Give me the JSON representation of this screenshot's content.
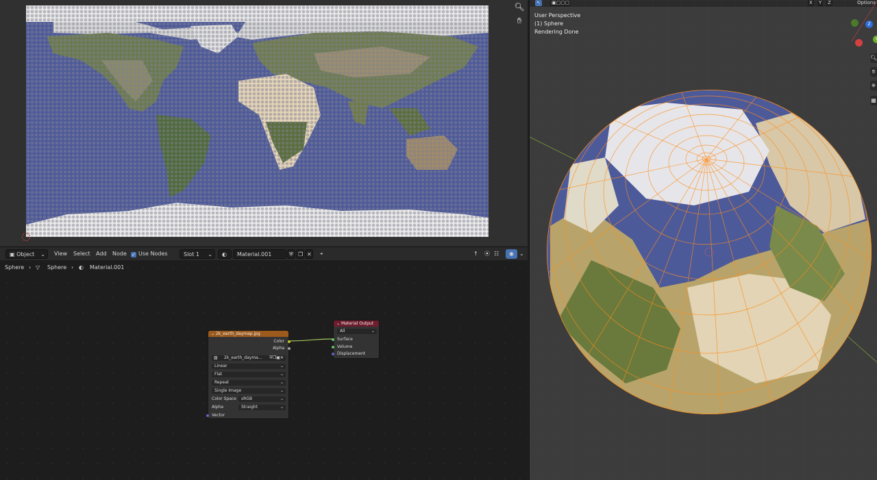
{
  "uv_editor": {
    "tools": {
      "zoom_icon": "zoom-icon",
      "pan_icon": "hand-icon"
    }
  },
  "node_editor": {
    "header": {
      "mode": "Object",
      "menu_view": "View",
      "menu_select": "Select",
      "menu_add": "Add",
      "menu_node": "Node",
      "use_nodes_label": "Use Nodes",
      "slot": "Slot 1",
      "material": "Material.001"
    },
    "breadcrumb": {
      "object": "Sphere",
      "mesh": "Sphere",
      "material": "Material.001"
    },
    "image_node": {
      "title": "2k_earth_daymap.jpg",
      "out_color": "Color",
      "out_alpha": "Alpha",
      "image_name": "2k_earth_dayma...",
      "interpolation": "Linear",
      "projection": "Flat",
      "extension": "Repeat",
      "source": "Single Image",
      "color_space_label": "Color Space",
      "color_space": "sRGB",
      "alpha_label": "Alpha",
      "alpha_mode": "Straight",
      "in_vector": "Vector",
      "header_color": "#9c5a1d"
    },
    "output_node": {
      "title": "Material Output",
      "target": "All",
      "in_surface": "Surface",
      "in_volume": "Volume",
      "in_displacement": "Displacement",
      "header_color": "#6e1d2d"
    }
  },
  "viewport": {
    "info_line1": "User Perspective",
    "info_line2": "(1) Sphere",
    "info_line3": "Rendering Done",
    "axis_x": "X",
    "axis_y": "Y",
    "axis_z": "Z",
    "options_label": "Options",
    "gizmo_z": "Z",
    "gizmo_y": "Y"
  },
  "colors": {
    "accent": "#4772b3",
    "wire": "#ff8c1a",
    "ocean": "#4d5a9a",
    "socket_color": "#c7c729",
    "socket_shader": "#63c763",
    "socket_vector": "#6363c7"
  }
}
